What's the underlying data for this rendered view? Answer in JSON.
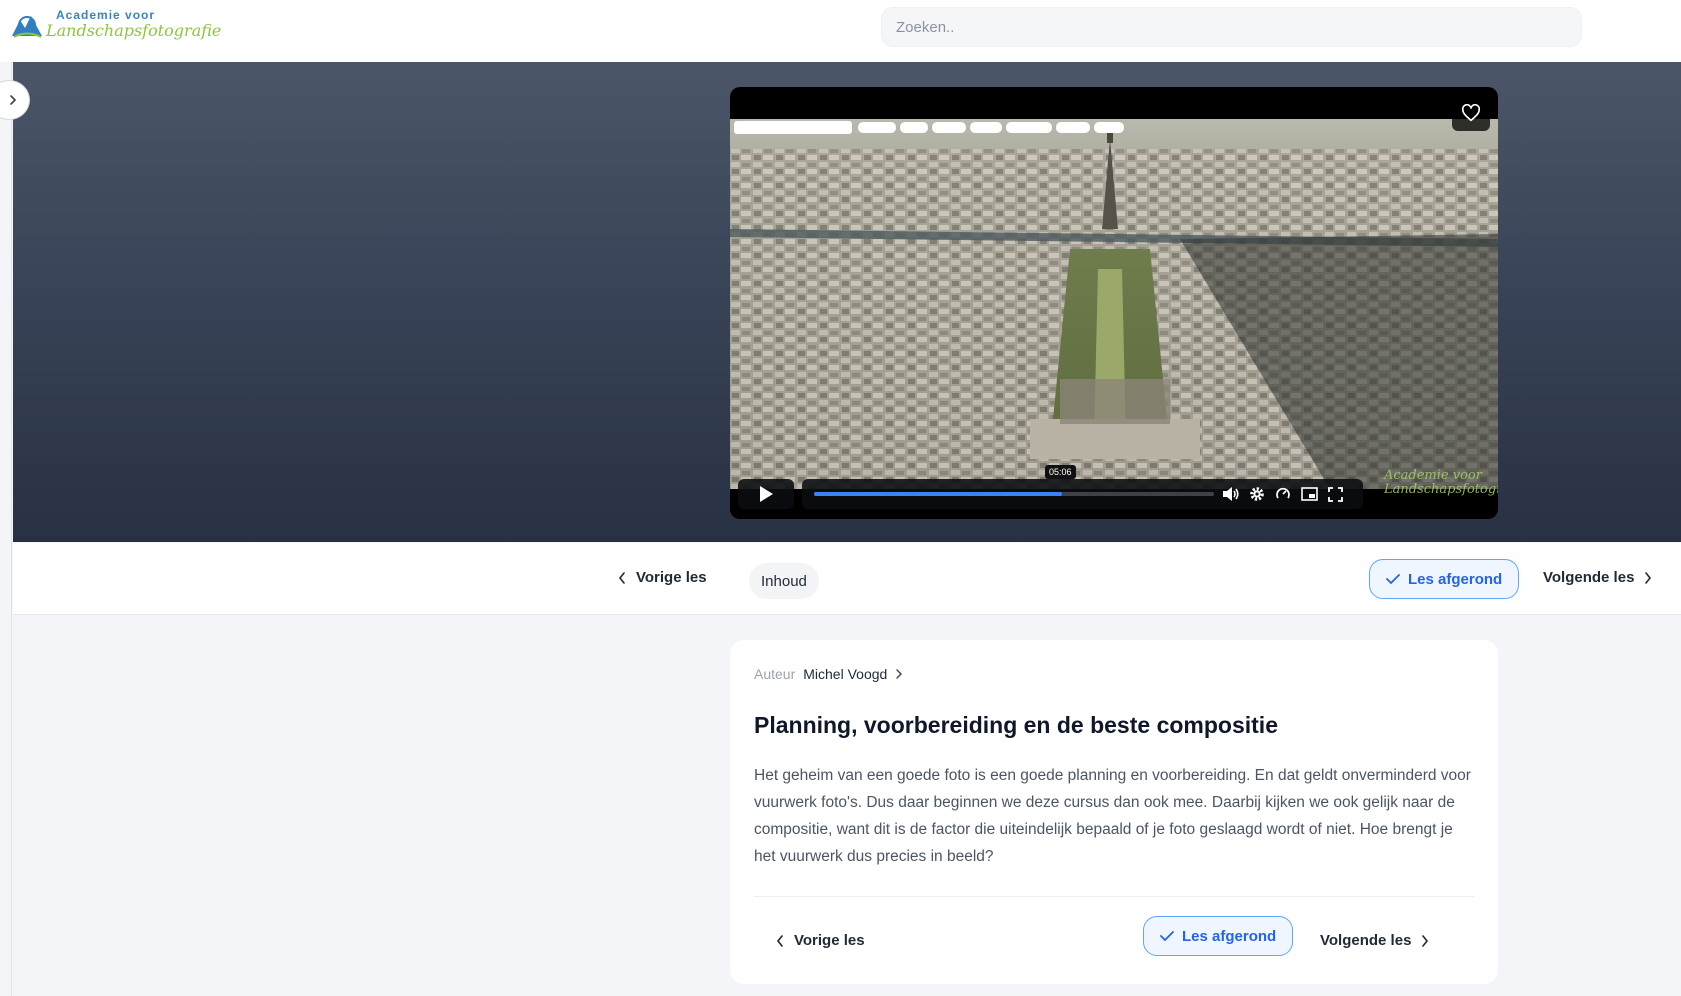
{
  "header": {
    "logo_line1": "Academie voor",
    "logo_line2": "Landschapsfotografie",
    "search_placeholder": "Zoeken.."
  },
  "video": {
    "hover_time": "05:06",
    "progress_fraction": 0.62,
    "watermark_line1": "Academie voor",
    "watermark_line2": "Landschapsfotografie",
    "icons": [
      "heart-icon",
      "play-icon",
      "volume-icon",
      "settings-icon",
      "speed-icon",
      "picture-in-picture-icon",
      "fullscreen-icon"
    ]
  },
  "lesson_nav": {
    "previous_label": "Vorige les",
    "contents_label": "Inhoud",
    "completed_label": "Les afgerond",
    "next_label": "Volgende les"
  },
  "lesson": {
    "author_label": "Auteur",
    "author_name": "Michel Voogd",
    "title": "Planning, voorbereiding en de beste compositie",
    "description": "Het geheim van een goede foto is een goede planning en voorbereiding. En dat geldt onverminderd voor vuurwerk foto's. Dus daar beginnen we deze cursus dan ook mee. Daarbij kijken we ook gelijk naar de compositie, want dit is de factor die uiteindelijk bepaald of je foto geslaagd wordt of niet. Hoe brengt je het vuurwerk dus precies in beeld?"
  },
  "colors": {
    "accent": "#2563eb",
    "accent_border": "#60a5fa",
    "hero_top": "#4b5668",
    "hero_bottom": "#283143"
  }
}
